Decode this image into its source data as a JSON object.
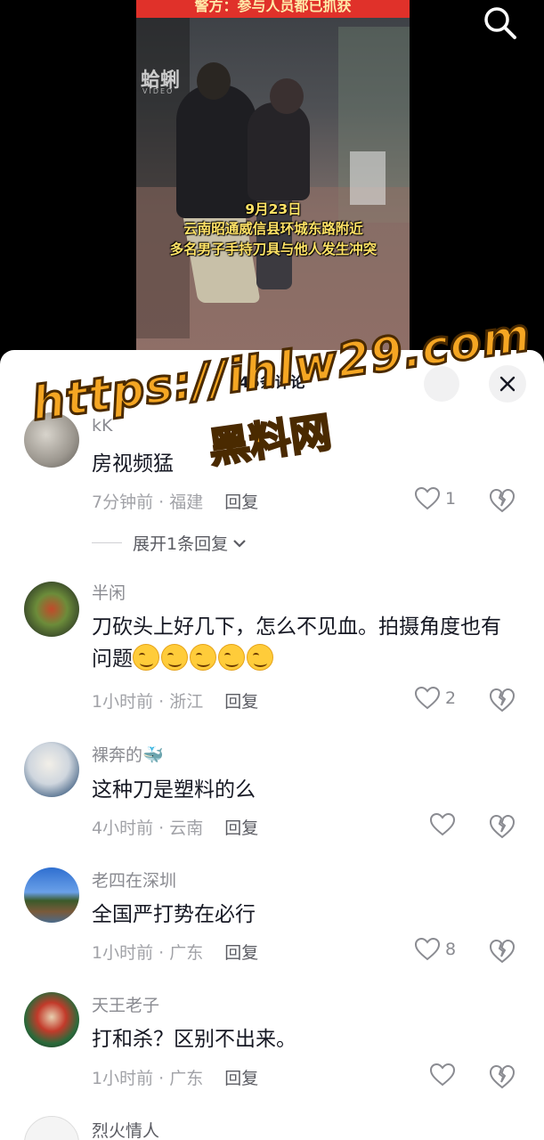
{
  "video": {
    "banner": "警方：参与人员都已抓获",
    "watermark": "蛤蜊",
    "watermark_sub": "VIDEO",
    "caption_lines": [
      "9月23日",
      "云南昭通威信县环城东路附近",
      "多名男子手持刀具与他人发生冲突"
    ]
  },
  "search_icon": "search-icon",
  "sheet": {
    "title": "45条评论",
    "close_icon": "close-icon"
  },
  "overlay": {
    "url": "https://ihlw29.com",
    "name": "黑料网"
  },
  "comments": [
    {
      "user": "kK",
      "text": "房视频猛",
      "time": "7分钟前",
      "location": "福建",
      "reply": "回复",
      "likes": "1",
      "expand": "展开1条回复"
    },
    {
      "user": "半闲",
      "text": "刀砍头上好几下，怎么不见血。拍摄角度也有问题",
      "time": "1小时前",
      "location": "浙江",
      "reply": "回复",
      "likes": "2"
    },
    {
      "user": "裸奔的🐳",
      "text": "这种刀是塑料的么",
      "time": "4小时前",
      "location": "云南",
      "reply": "回复",
      "likes": ""
    },
    {
      "user": "老四在深圳",
      "text": "全国严打势在必行",
      "time": "1小时前",
      "location": "广东",
      "reply": "回复",
      "likes": "8"
    },
    {
      "user": "天王老子",
      "text": "打和杀？区别不出来。",
      "time": "1小时前",
      "location": "广东",
      "reply": "回复",
      "likes": ""
    },
    {
      "user": "烈火情人"
    }
  ],
  "colors": {
    "accent": "#e0312a",
    "caption": "#ffe266",
    "overlay": "#f5a623"
  }
}
